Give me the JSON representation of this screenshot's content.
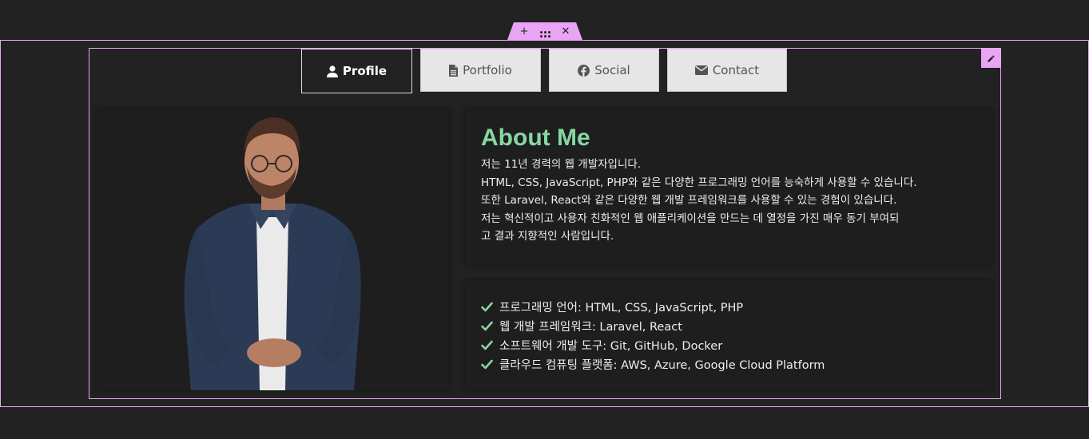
{
  "editor": {
    "add_icon": "plus-icon",
    "move_icon": "drag-dots-icon",
    "close_icon": "close-icon",
    "edit_icon": "pencil-icon",
    "accent": "#eaa4f5"
  },
  "tabs": [
    {
      "label": "Profile",
      "icon": "user-icon",
      "active": true
    },
    {
      "label": "Portfolio",
      "icon": "file-icon",
      "active": false
    },
    {
      "label": "Social",
      "icon": "facebook-icon",
      "active": false
    },
    {
      "label": "Contact",
      "icon": "envelope-icon",
      "active": false
    }
  ],
  "about": {
    "title": "About Me",
    "lines": [
      "저는 11년 경력의 웹 개발자입니다.",
      "HTML, CSS, JavaScript, PHP와 같은 다양한 프로그래밍 언어를 능숙하게 사용할 수 있습니다.",
      "또한 Laravel, React와 같은 다양한 웹 개발 프레임워크를 사용할 수 있는 경험이 있습니다.",
      "저는 혁신적이고 사용자 친화적인 웹 애플리케이션을 만드는 데 열정을 가진 매우 동기 부여되",
      "고 결과 지향적인 사람입니다."
    ],
    "title_color": "#86d8a0"
  },
  "skills": [
    "프로그래밍 언어: HTML, CSS, JavaScript, PHP",
    "웹 개발 프레임워크: Laravel, React",
    "소프트웨어 개발 도구: Git, GitHub, Docker",
    "클라우드 컴퓨팅 플랫폼: AWS, Azure, Google Cloud Platform"
  ],
  "check_color": "#86d8a0"
}
